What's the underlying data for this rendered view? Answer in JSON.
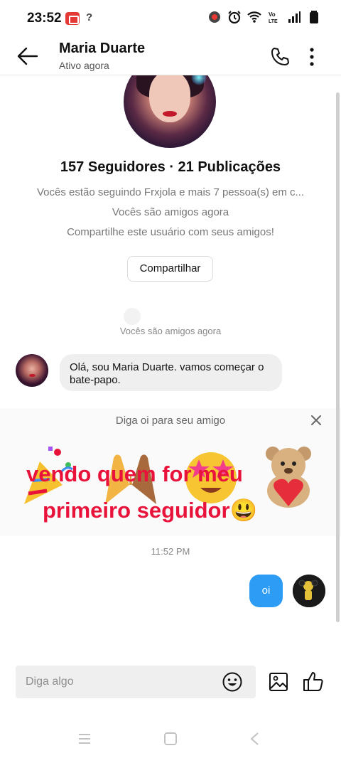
{
  "status_bar": {
    "time": "23:52",
    "unknown_glyph": "?",
    "icons": [
      "record-icon",
      "alarm-icon",
      "wifi-icon",
      "volte-icon",
      "signal-icon",
      "battery-icon"
    ]
  },
  "header": {
    "name": "Maria Duarte",
    "status": "Ativo agora"
  },
  "profile": {
    "stats": "157 Seguidores · 21 Publicações",
    "following_line": "Vocês estão seguindo Frxjola e mais 7 pessoa(s) em c...",
    "friends_line": "Vocês são amigos agora",
    "share_prompt": "Compartilhe este usuário com seus amigos!",
    "share_button": "Compartilhar"
  },
  "conversation": {
    "friends_notice": "Vocês são amigos agora",
    "incoming_message": "Olá, sou Maria Duarte. vamos começar o bate-papo.",
    "greeting_prompt": "Diga oi para seu amigo",
    "stickers": [
      "party-popper-sticker",
      "high-five-sticker",
      "star-eyes-sticker",
      "teddy-bear-heart-sticker"
    ],
    "overlay_line1": "vendo quem for meu",
    "overlay_line2": "primeiro seguidor😃",
    "timestamp": "11:52 PM",
    "outgoing_message": "oi"
  },
  "composer": {
    "placeholder": "Diga algo"
  },
  "colors": {
    "accent_blue": "#2d9cf5",
    "overlay_red": "#e8123a",
    "record_red": "#e53935"
  }
}
